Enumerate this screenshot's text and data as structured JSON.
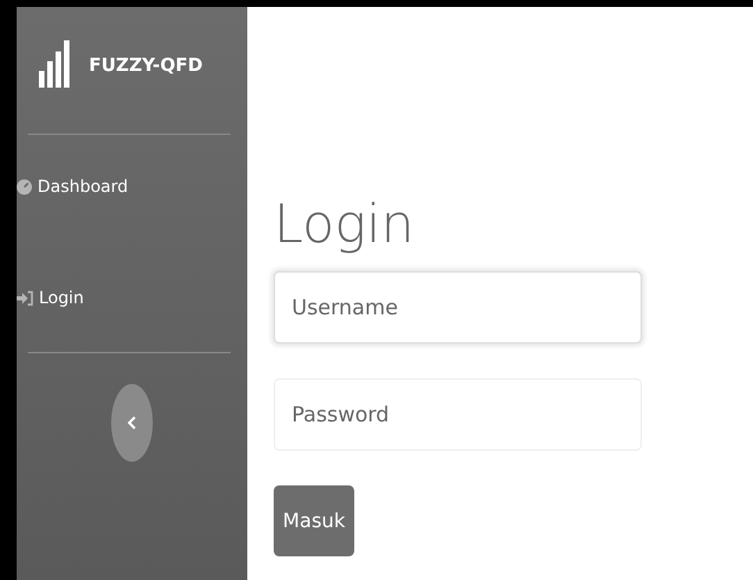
{
  "sidebar": {
    "brand": "FUZZY-QFD",
    "items": [
      {
        "label": "Dashboard",
        "kind": "dashboard"
      },
      {
        "label": "Login",
        "kind": "login"
      }
    ]
  },
  "main": {
    "heading": "Login",
    "fields": [
      {
        "placeholder": "Username",
        "focused": true
      },
      {
        "placeholder": "Password",
        "focused": false
      }
    ],
    "button": "Masuk"
  }
}
